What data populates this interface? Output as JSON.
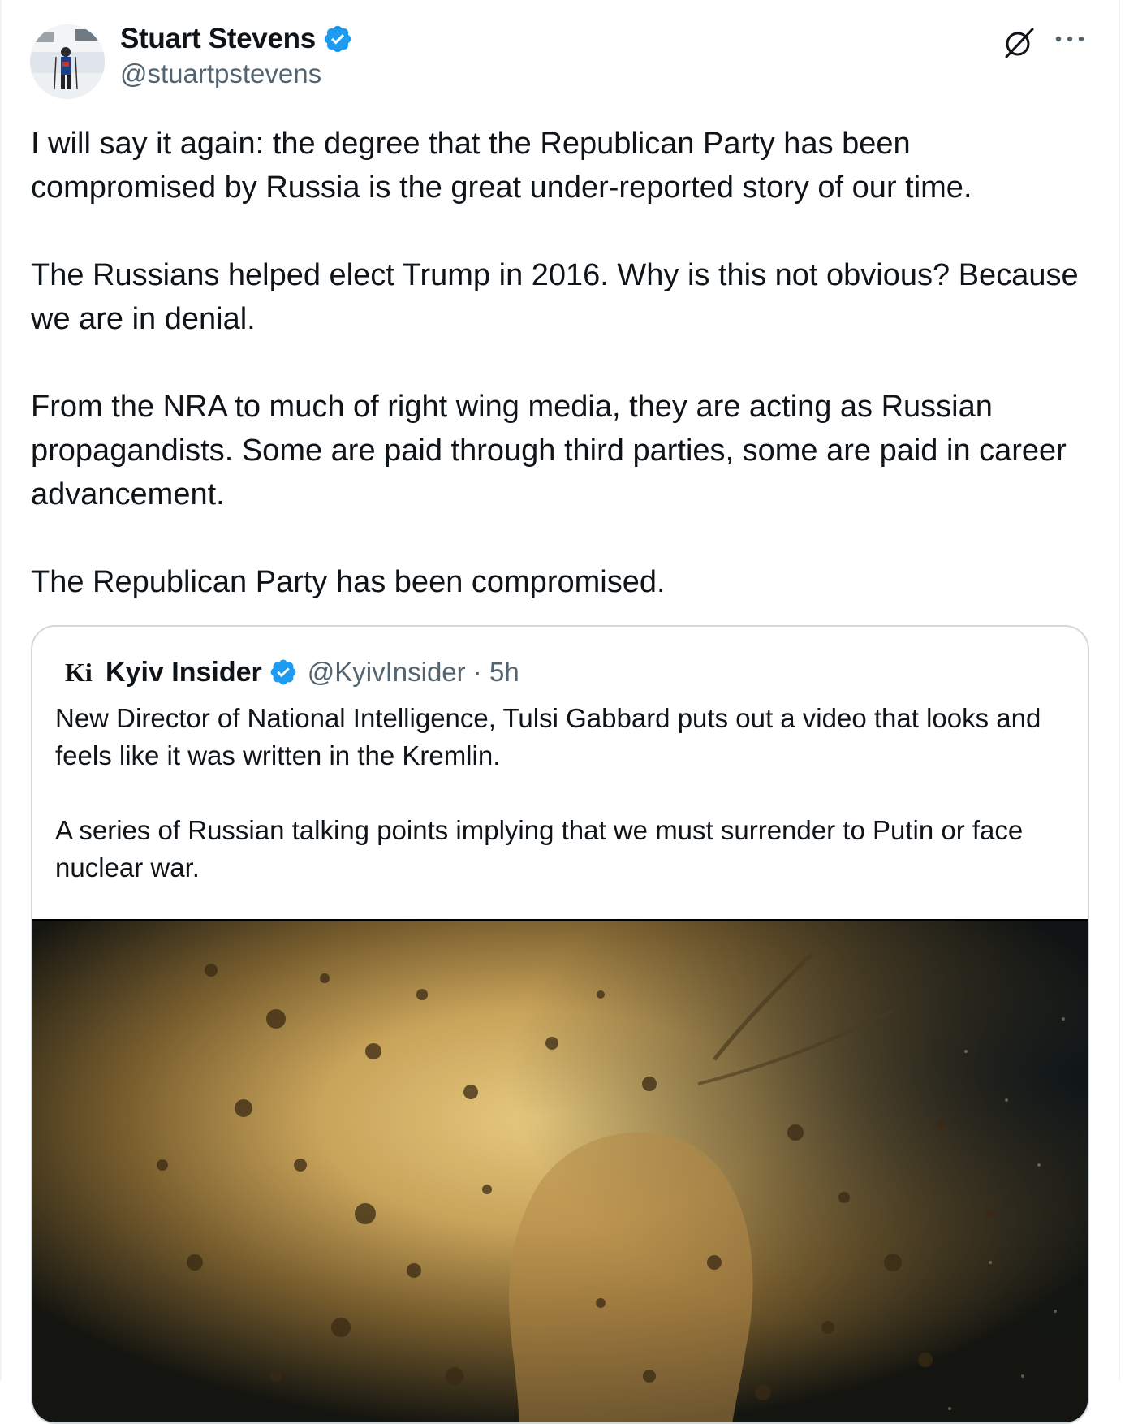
{
  "author": {
    "name": "Stuart Stevens",
    "handle": "@stuartpstevens",
    "verified": true
  },
  "tweet": {
    "paragraphs": [
      "I will say it again: the degree that the Republican Party has been compromised by Russia is the great under-reported story of our time.",
      "The Russians helped elect Trump in 2016.  Why is this not obvious? Because we are in denial.",
      "From the NRA to much of right wing media, they are acting as Russian propagandists. Some are paid through third parties, some are paid in career advancement.",
      "The Republican Party has been compromised."
    ]
  },
  "quoted_tweet": {
    "logo_text": "Ki",
    "name": "Kyiv Insider",
    "handle_time": "@KyivInsider · 5h",
    "verified": true,
    "paragraphs": [
      "New Director of National Intelligence, Tulsi Gabbard puts out a video that looks and feels like it was written in the Kremlin.",
      "A series of Russian talking points implying that we must surrender to Putin or face nuclear war."
    ],
    "media": {
      "type": "video-thumbnail",
      "dominant_colors": [
        "#c8a35a",
        "#8a6a32",
        "#1a1a14"
      ]
    }
  },
  "icons": {
    "verified": "verified-badge-icon",
    "grok": "grok-icon",
    "more": "more-options-icon"
  },
  "colors": {
    "text": "#0f1419",
    "secondary_text": "#536471",
    "verified_blue": "#1d9bf0",
    "border": "#cfd9de"
  }
}
